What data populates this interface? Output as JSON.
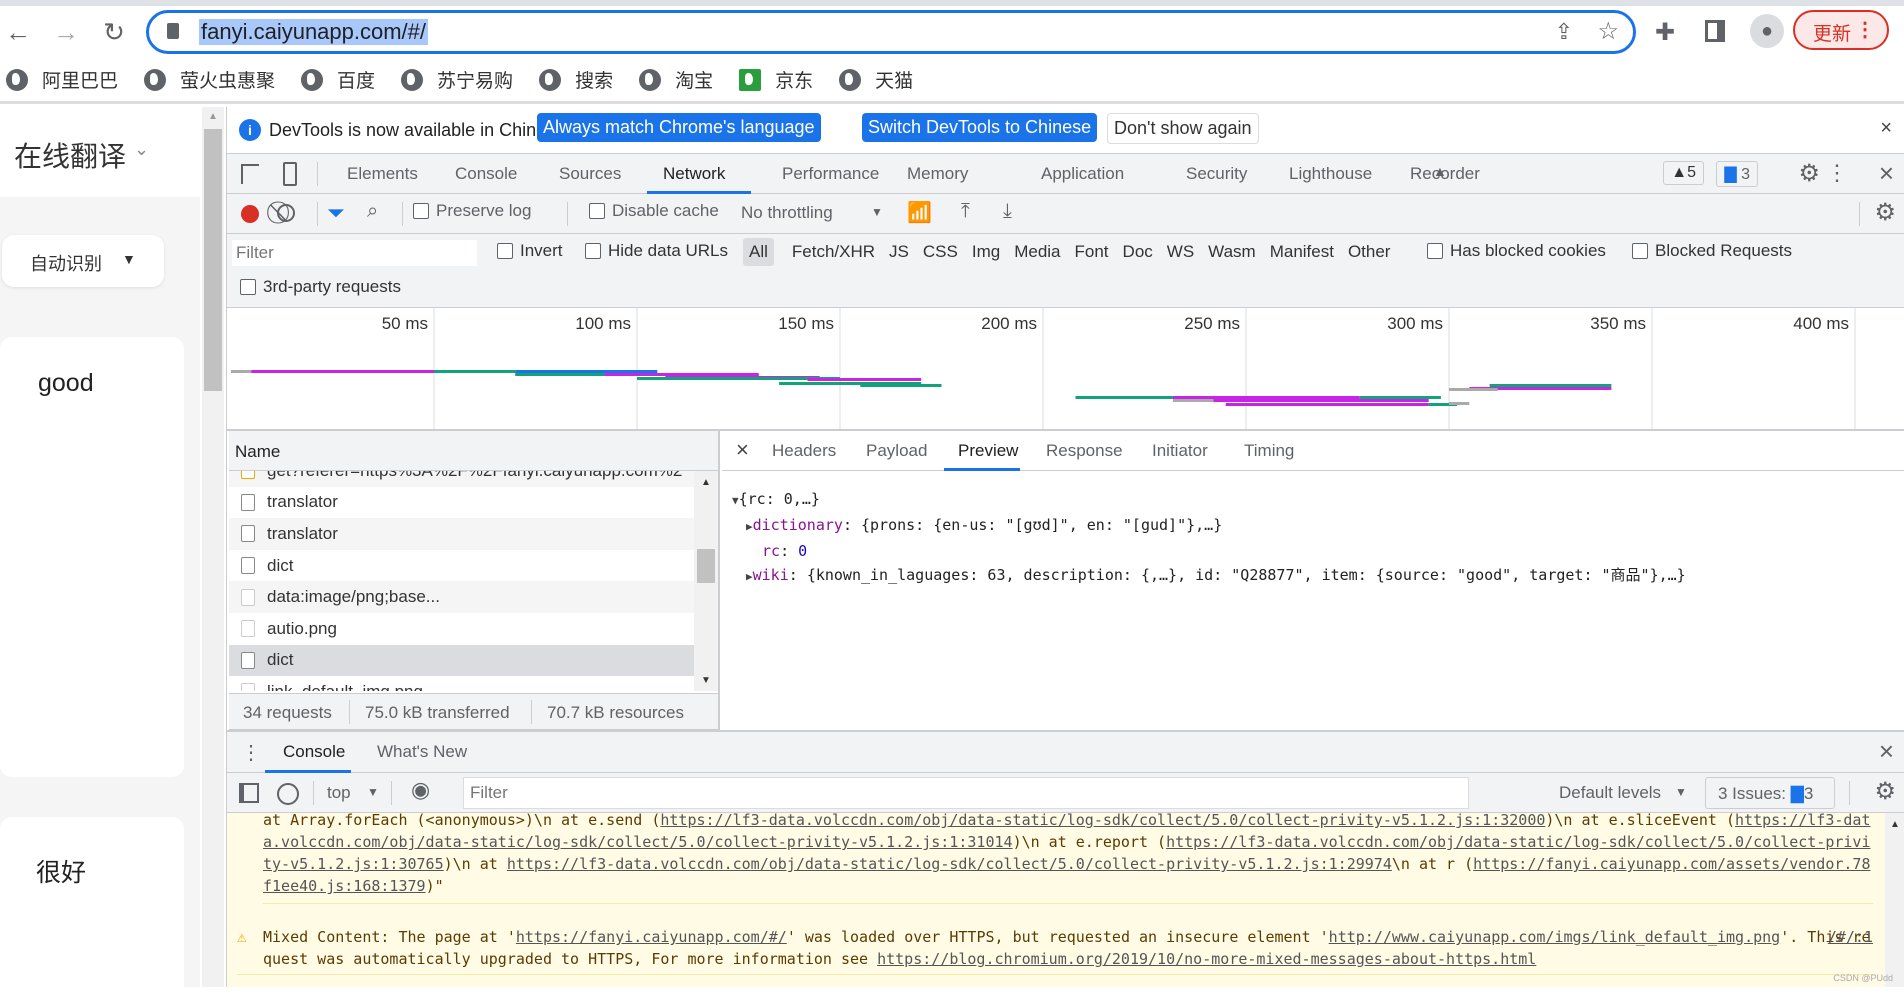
{
  "browser": {
    "url": "fanyi.caiyunapp.com/#/",
    "update_label": "更新",
    "bookmarks": [
      "阿里巴巴",
      "萤火虫惠聚",
      "百度",
      "苏宁易购",
      "搜索",
      "淘宝",
      "京东",
      "天猫"
    ]
  },
  "page": {
    "title": "在线翻译",
    "source_lang": "自动识别",
    "input_text": "good",
    "output_text": "很好"
  },
  "infobar": {
    "message": "DevTools is now available in Chinese!",
    "btn_match": "Always match Chrome's language",
    "btn_switch": "Switch DevTools to Chinese",
    "btn_dismiss": "Don't show again"
  },
  "devtools": {
    "tabs": [
      "Elements",
      "Console",
      "Sources",
      "Network",
      "Performance",
      "Memory",
      "Application",
      "Security",
      "Lighthouse",
      "Recorder"
    ],
    "active_tab": "Network",
    "warnings_count": "5",
    "messages_count": "3"
  },
  "network": {
    "preserve_log": "Preserve log",
    "disable_cache": "Disable cache",
    "throttling": "No throttling",
    "filter_placeholder": "Filter",
    "invert": "Invert",
    "hide_data_urls": "Hide data URLs",
    "types": [
      "All",
      "Fetch/XHR",
      "JS",
      "CSS",
      "Img",
      "Media",
      "Font",
      "Doc",
      "WS",
      "Wasm",
      "Manifest",
      "Other"
    ],
    "has_blocked_cookies": "Has blocked cookies",
    "blocked_requests": "Blocked Requests",
    "third_party": "3rd-party requests",
    "timeline_ticks": [
      "50 ms",
      "100 ms",
      "150 ms",
      "200 ms",
      "250 ms",
      "300 ms",
      "350 ms",
      "400 ms"
    ],
    "name_header": "Name",
    "requests": [
      {
        "name": "get?referer=https%3A%2F%2Ffanyi.caiyunapp.com%2",
        "type": "script"
      },
      {
        "name": "translator",
        "type": "xhr"
      },
      {
        "name": "translator",
        "type": "xhr"
      },
      {
        "name": "dict",
        "type": "xhr"
      },
      {
        "name": "data:image/png;base...",
        "type": "img"
      },
      {
        "name": "autio.png",
        "type": "img"
      },
      {
        "name": "dict",
        "type": "xhr",
        "selected": true
      },
      {
        "name": "link_default_img.png",
        "type": "img"
      }
    ],
    "status": {
      "requests": "34 requests",
      "transferred": "75.0 kB transferred",
      "resources": "70.7 kB resources"
    },
    "detail_tabs": [
      "Headers",
      "Payload",
      "Preview",
      "Response",
      "Initiator",
      "Timing"
    ],
    "active_detail_tab": "Preview",
    "preview": {
      "root": "{rc: 0,…}",
      "dictionary_key": "dictionary",
      "dictionary_val": "{prons: {en-us: \"[gʊd]\", en: \"[gud]\"},…}",
      "rc_key": "rc",
      "rc_val": "0",
      "wiki_key": "wiki",
      "wiki_val": "{known_in_laguages: 63, description: {,…}, id: \"Q28877\", item: {source: \"good\", target: \"商品\"},…}"
    }
  },
  "console": {
    "tabs": [
      "Console",
      "What's New"
    ],
    "context": "top",
    "filter_placeholder": "Filter",
    "levels": "Default levels",
    "issues_label": "3 Issues:",
    "issues_count": "3",
    "log1": [
      "at Array.forEach (<anonymous>)\\n    at e.send (",
      "https://lf3-data.volccdn.com/obj/data-static/log-sdk/collect/5.0/collect-privity-v5.1.2.js:1:32000",
      ")\\n    at e.sliceEvent (",
      "https://lf3-data.volccdn.com/obj/data-static/log-sdk/collect/5.0/collect-privity-v5.1.2.js:1:31014",
      ")\\n    at e.report (",
      "https://lf3-data.volccdn.com/obj/data-static/log-sdk/collect/5.0/collect-privity-v5.1.2.js:1:30765",
      ")\\n    at ",
      "https://lf3-data.volccdn.com/obj/data-static/log-sdk/collect/5.0/collect-privity-v5.1.2.js:1:29974",
      "\\n    at r (",
      "https://fanyi.caiyunapp.com/assets/vendor.78f1ee40.js:168:1379",
      ")\""
    ],
    "warn": {
      "t1": "Mixed Content: The page at '",
      "l1": "https://fanyi.caiyunapp.com/#/",
      "t2": "' was loaded over HTTPS, but requested an insecure element '",
      "l2": "http://www.caiyunapp.com/imgs/link_default_img.png",
      "t3": "'. This request was automatically upgraded to HTTPS, For more information see ",
      "l3": "https://blog.chromium.org/2019/10/no-more-mixed-messages-about-https.html",
      "source": "/#/:1"
    }
  },
  "watermark": "CSDN @PUdd",
  "colors": {
    "accent": "#1a73e8",
    "record": "#d93025",
    "warn_bg": "#fffbe5",
    "key": "#881391"
  }
}
